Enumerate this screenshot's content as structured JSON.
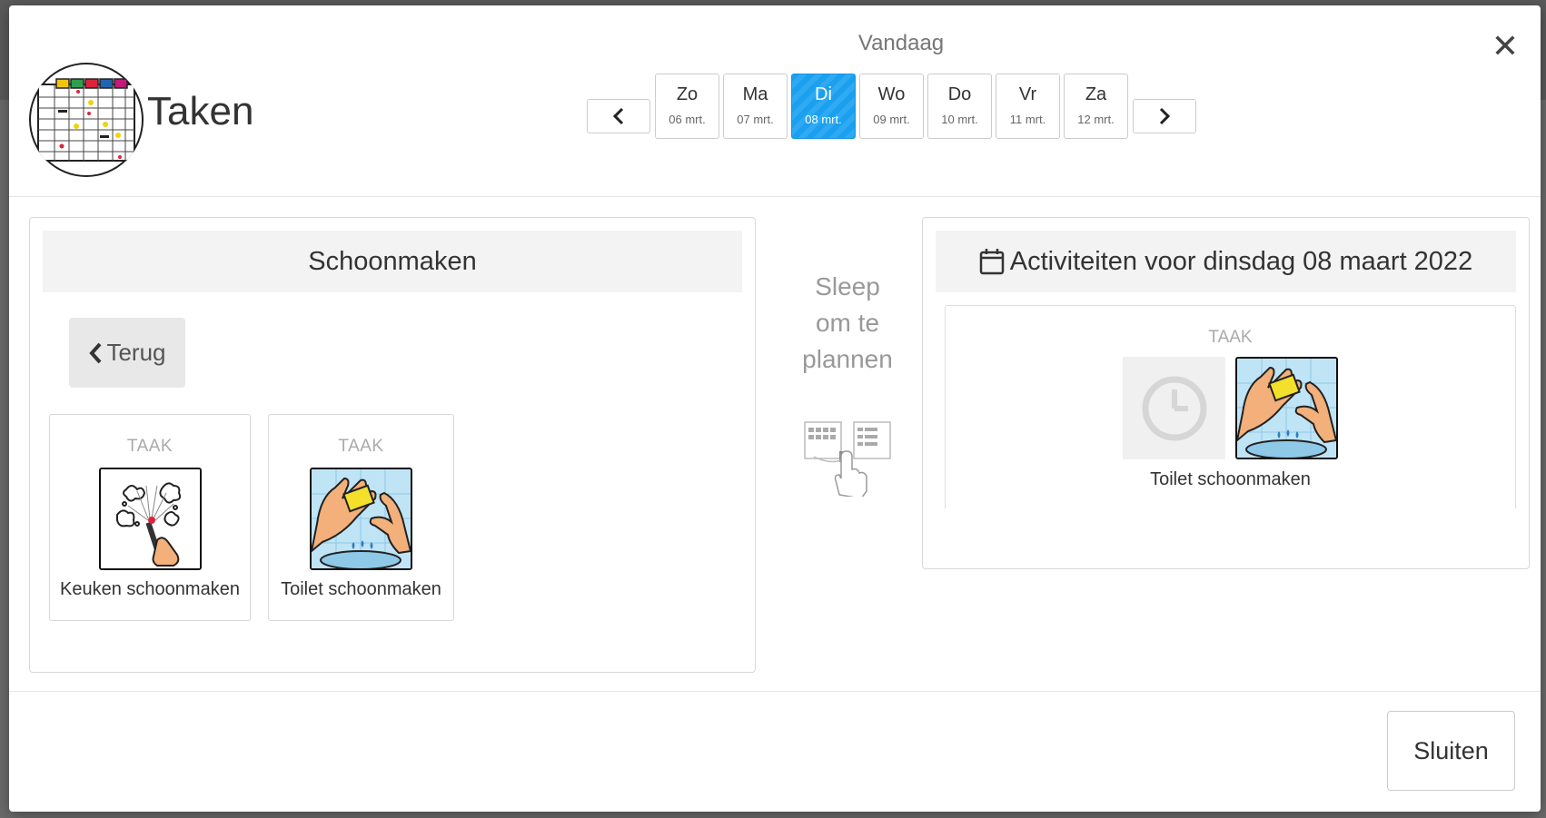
{
  "header": {
    "title": "Taken",
    "today_label": "Vandaag",
    "days": [
      {
        "name": "Zo",
        "date": "06 mrt."
      },
      {
        "name": "Ma",
        "date": "07 mrt."
      },
      {
        "name": "Di",
        "date": "08 mrt."
      },
      {
        "name": "Wo",
        "date": "09 mrt."
      },
      {
        "name": "Do",
        "date": "10 mrt."
      },
      {
        "name": "Vr",
        "date": "11 mrt."
      },
      {
        "name": "Za",
        "date": "12 mrt."
      }
    ],
    "active_day": "Di",
    "accent_color": "#1aa0ee"
  },
  "left_panel": {
    "title": "Schoonmaken",
    "back_label": "Terug",
    "cards": [
      {
        "tag": "TAAK",
        "label": "Keuken schoonmaken",
        "icon": "cleaning-spray-icon"
      },
      {
        "tag": "TAAK",
        "label": "Toilet schoonmaken",
        "icon": "washing-hands-icon"
      }
    ]
  },
  "middle": {
    "hint": "Sleep om te plannen",
    "icon": "drag-to-schedule-icon"
  },
  "right_panel": {
    "title": "Activiteiten voor dinsdag 08 maart 2022",
    "scheduled": {
      "tag": "TAAK",
      "label": "Toilet schoonmaken",
      "time_icon": "clock-icon",
      "icon": "washing-hands-icon"
    }
  },
  "footer": {
    "close_label": "Sluiten"
  }
}
